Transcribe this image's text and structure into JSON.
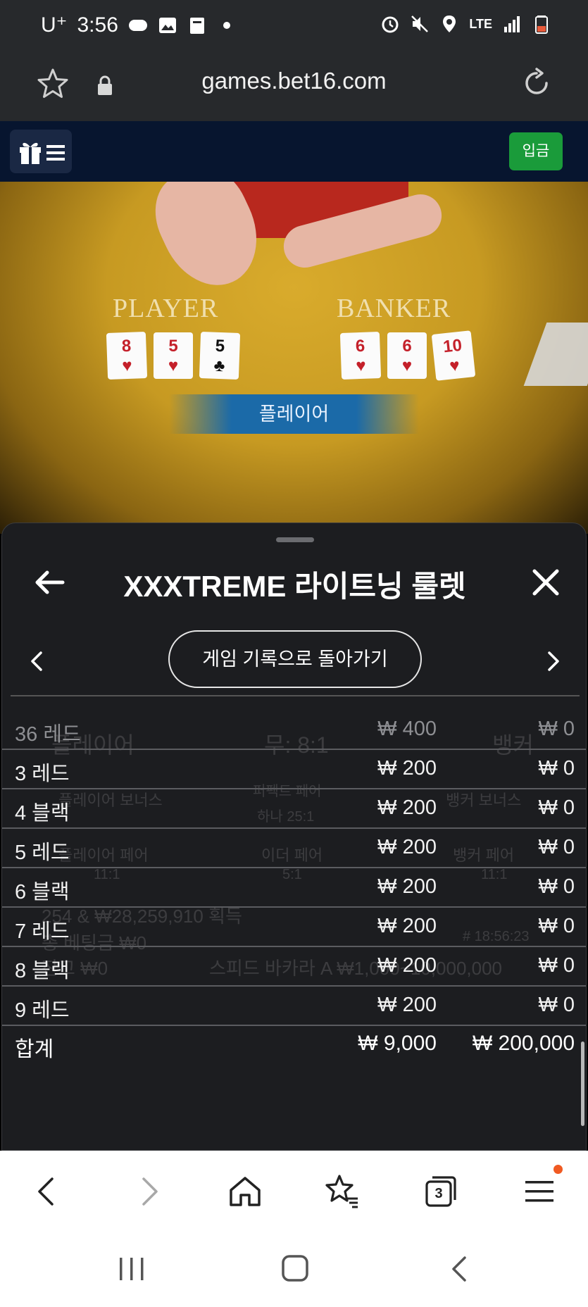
{
  "status_bar": {
    "carrier": "U⁺",
    "time": "3:56",
    "network": "LTE"
  },
  "browser": {
    "url": "games.bet16.com"
  },
  "site_header": {
    "deposit_label": "입금"
  },
  "video": {
    "player_label": "PLAYER",
    "banker_label": "BANKER",
    "player_cards": [
      {
        "rank": "8",
        "suit": "♥",
        "color": "red"
      },
      {
        "rank": "5",
        "suit": "♥",
        "color": "red"
      },
      {
        "rank": "5",
        "suit": "♣",
        "color": "black"
      }
    ],
    "banker_cards": [
      {
        "rank": "6",
        "suit": "♥",
        "color": "red"
      },
      {
        "rank": "6",
        "suit": "♥",
        "color": "red"
      },
      {
        "rank": "10",
        "suit": "♥",
        "color": "red"
      }
    ],
    "result_banner": "플레이어"
  },
  "sheet": {
    "title": "XXXTREME 라이트닝 룰렛",
    "history_button_label": "게임 기록으로 돌아가기",
    "bets": [
      {
        "name": "36 레드",
        "bet": "₩ 400",
        "win": "₩ 0"
      },
      {
        "name": "3 레드",
        "bet": "₩ 200",
        "win": "₩ 0"
      },
      {
        "name": "4 블랙",
        "bet": "₩ 200",
        "win": "₩ 0"
      },
      {
        "name": "5 레드",
        "bet": "₩ 200",
        "win": "₩ 0"
      },
      {
        "name": "6 블랙",
        "bet": "₩ 200",
        "win": "₩ 0"
      },
      {
        "name": "7 레드",
        "bet": "₩ 200",
        "win": "₩ 0"
      },
      {
        "name": "8 블랙",
        "bet": "₩ 200",
        "win": "₩ 0"
      },
      {
        "name": "9 레드",
        "bet": "₩ 200",
        "win": "₩ 0"
      }
    ],
    "total": {
      "name": "합계",
      "bet": "₩ 9,000",
      "win": "₩ 200,000"
    }
  },
  "background_overlay": {
    "player": "플레이어",
    "tie": "무: 8:1",
    "banker": "뱅커",
    "player_bonus": "플레이어 보너스",
    "perfect_pair": "퍼펙트 페어",
    "perfect_pair_odds": "하나 25:1",
    "banker_bonus": "뱅커 보너스",
    "player_pair": "플레이어 페어",
    "player_pair_odds": "11:1",
    "either_pair": "이더 페어",
    "either_pair_odds": "5:1",
    "banker_pair": "뱅커 페어",
    "banker_pair_odds": "11:1",
    "winners": "254 & ₩28,259,910 획득",
    "total_bet": "총 베팅금 ₩0",
    "balance": "잔고 ₩0",
    "table_info": "스피드 바카라 A ₩1,000~10,000,000",
    "game_id": "# 18:56:23"
  },
  "toolbar": {
    "tabs_count": "3"
  }
}
